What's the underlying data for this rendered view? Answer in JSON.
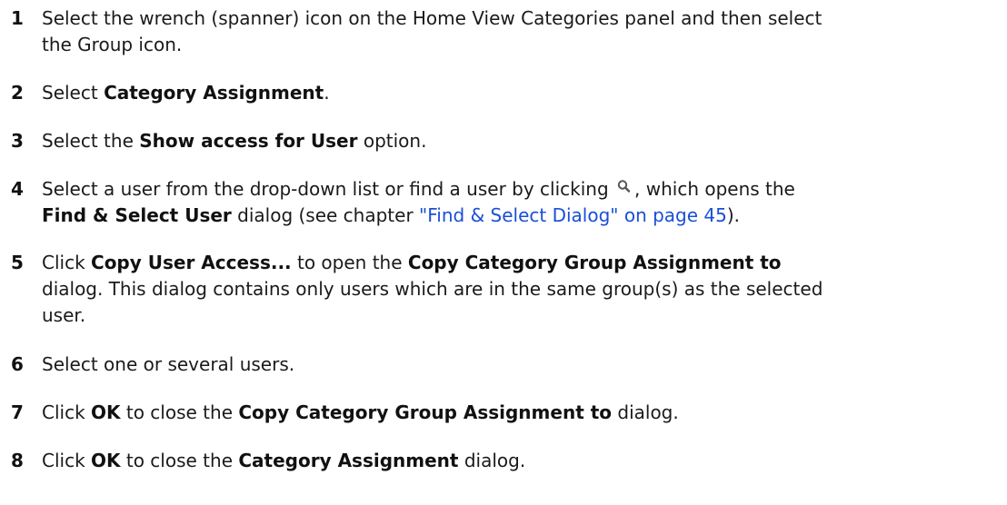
{
  "steps": [
    {
      "number": "1",
      "line1": "Select the wrench (spanner) icon on the Home View Categories panel and then select",
      "line2": "the Group icon."
    },
    {
      "number": "2",
      "pre": "Select ",
      "bold": "Category Assignment",
      "post": "."
    },
    {
      "number": "3",
      "pre": "Select the ",
      "bold": "Show access for User",
      "post": " option."
    },
    {
      "number": "4",
      "line1_pre": "Select a user from the drop-down list or find a user by clicking ",
      "line1_post": ", which opens the",
      "icon": "search-icon",
      "line2_bold": "Find & Select User",
      "line2_mid": " dialog (see chapter ",
      "line2_link": "\"Find & Select Dialog\" on page 45",
      "line2_post": ")."
    },
    {
      "number": "5",
      "line1_pre": "Click ",
      "line1_bold1": "Copy User Access...",
      "line1_mid": " to open the ",
      "line1_bold2": "Copy Category Group Assignment to",
      "line2": "dialog. This dialog contains only users which are in the same group(s) as the selected",
      "line3": "user."
    },
    {
      "number": "6",
      "text": "Select one or several users."
    },
    {
      "number": "7",
      "pre": "Click ",
      "bold1": "OK",
      "mid": " to close the ",
      "bold2": "Copy Category Group Assignment to",
      "post": " dialog."
    },
    {
      "number": "8",
      "pre": "Click ",
      "bold1": "OK",
      "mid": " to close the ",
      "bold2": "Category Assignment",
      "post": " dialog."
    }
  ]
}
